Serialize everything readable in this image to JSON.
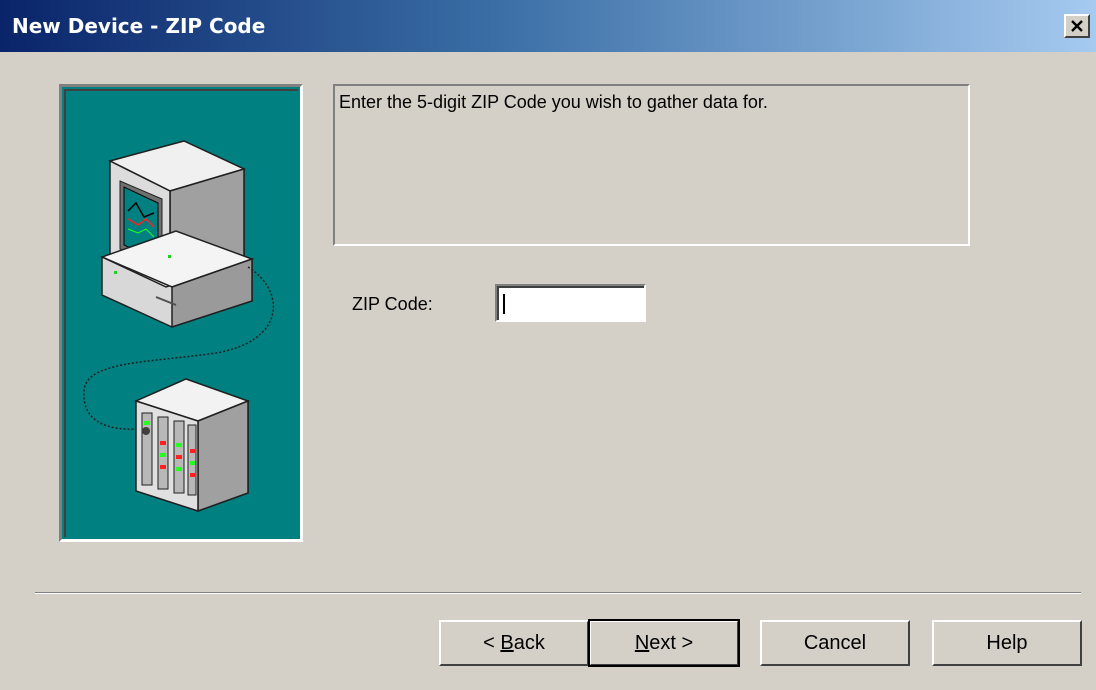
{
  "window": {
    "title": "New Device - ZIP Code",
    "close_glyph": "×"
  },
  "illustration": {
    "icon": "computer-to-device-icon",
    "background_color": "#008080"
  },
  "description": {
    "text": "Enter the 5-digit ZIP Code you wish to gather data for."
  },
  "zip": {
    "label": "ZIP Code:",
    "value": "",
    "placeholder": ""
  },
  "buttons": {
    "back_prefix": "< ",
    "back_mnemonic": "B",
    "back_rest": "ack",
    "next_mnemonic": "N",
    "next_rest": "ext >",
    "cancel": "Cancel",
    "help": "Help"
  },
  "colors": {
    "title_start": "#0a246a",
    "title_end": "#a6caf0",
    "face": "#d4d0c8"
  }
}
